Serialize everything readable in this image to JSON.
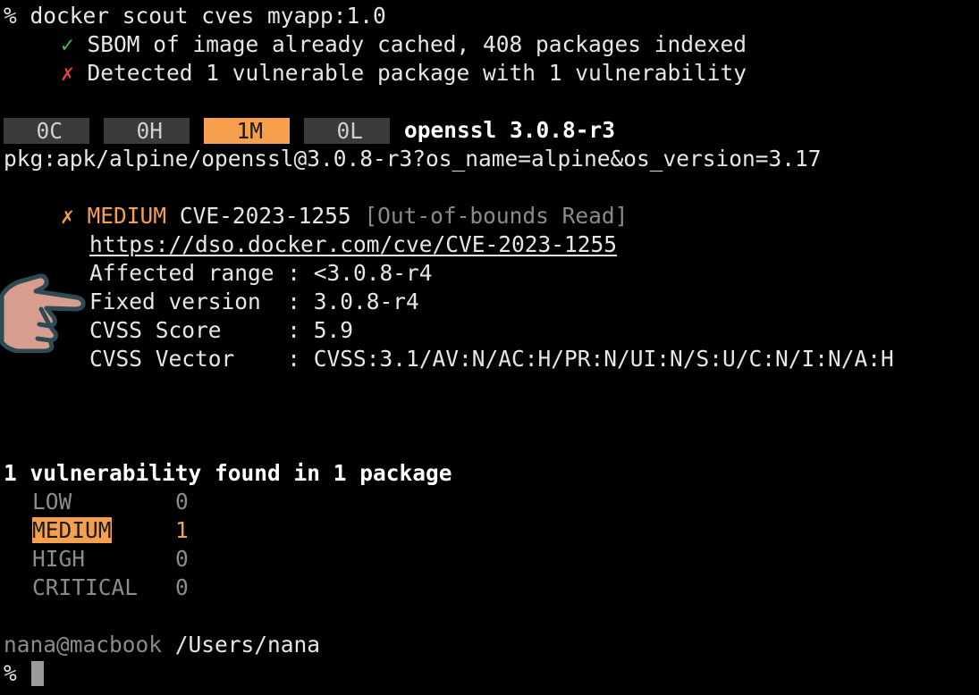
{
  "command": {
    "prompt_symbol": "%",
    "text": "docker scout cves myapp:1.0"
  },
  "status": [
    {
      "icon": "✓",
      "text": "SBOM of image already cached, 408 packages indexed"
    },
    {
      "icon": "✗",
      "text": "Detected 1 vulnerable package with 1 vulnerability"
    }
  ],
  "badges": [
    {
      "label": "0C"
    },
    {
      "label": "0H"
    },
    {
      "label": "1M"
    },
    {
      "label": "0L"
    }
  ],
  "package": {
    "name": "openssl 3.0.8-r3",
    "purl": "pkg:apk/alpine/openssl@3.0.8-r3?os_name=alpine&os_version=3.17"
  },
  "cve": {
    "icon": "✗",
    "severity": "MEDIUM",
    "id": "CVE-2023-1255",
    "type": "[Out-of-bounds Read]",
    "url": "https://dso.docker.com/cve/CVE-2023-1255",
    "details": [
      {
        "key": "Affected range",
        "value": "<3.0.8-r4"
      },
      {
        "key": "Fixed version ",
        "value": "3.0.8-r4"
      },
      {
        "key": "CVSS Score    ",
        "value": "5.9"
      },
      {
        "key": "CVSS Vector   ",
        "value": "CVSS:3.1/AV:N/AC:H/PR:N/UI:N/S:U/C:N/I:N/A:H"
      }
    ]
  },
  "summary": {
    "title": "1 vulnerability found in 1 package",
    "rows": [
      {
        "label": "LOW",
        "count": "0"
      },
      {
        "label": "MEDIUM",
        "count": "1"
      },
      {
        "label": "HIGH",
        "count": "0"
      },
      {
        "label": "CRITICAL",
        "count": "0"
      }
    ]
  },
  "shell": {
    "user_host": "nana@macbook",
    "cwd": "/Users/nana",
    "prompt_symbol": "%"
  },
  "colors": {
    "background": "#000000",
    "success": "#36c24a",
    "error": "#e2453a",
    "medium": "#f6a04d",
    "dim": "#8b8b8b"
  }
}
